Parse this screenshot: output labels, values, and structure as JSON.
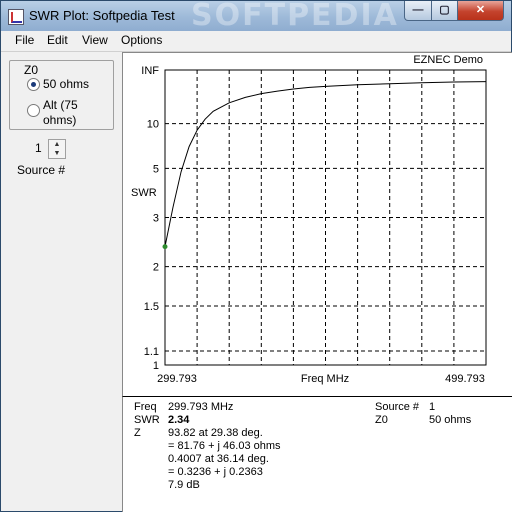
{
  "window": {
    "title": "SWR Plot: Softpedia Test",
    "watermark": "SOFTPEDIA",
    "buttons": {
      "minimize": "—",
      "maximize": "▢",
      "close": "✕"
    }
  },
  "menu": [
    "File",
    "Edit",
    "View",
    "Options"
  ],
  "z0_group": {
    "label": "Z0",
    "options": [
      {
        "label": "50 ohms",
        "selected": true
      },
      {
        "label": "Alt (75 ohms)",
        "selected": false
      }
    ]
  },
  "source": {
    "value": "1",
    "label": "Source #"
  },
  "chart_data": {
    "type": "line",
    "title": "EZNEC Demo",
    "xlabel": "Freq MHz",
    "ylabel": "SWR",
    "xlim": [
      299.793,
      499.793
    ],
    "x_tick_labels": [
      "299.793",
      "499.793"
    ],
    "y_tick_labels": [
      "INF",
      "10",
      "5",
      "3",
      "2",
      "1.5",
      "1.1",
      "1"
    ],
    "y_scale": "reflection-coefficient (SWR)",
    "grid": true,
    "series": [
      {
        "color": "#000000",
        "x": [
          299.793,
          304.8,
          309.8,
          314.8,
          319.8,
          324.8,
          329.8,
          339.8,
          349.8,
          359.8,
          369.8,
          379.8,
          389.8,
          399.8,
          419.8,
          439.8,
          459.8,
          479.8,
          499.793
        ],
        "y": [
          2.34,
          3.3,
          4.8,
          6.7,
          8.8,
          11.0,
          13.3,
          17.0,
          20.5,
          24.0,
          27.0,
          30.0,
          33.0,
          35.0,
          39.0,
          42.0,
          45.0,
          48.0,
          50.0
        ]
      }
    ],
    "marker": {
      "x": 299.793,
      "y": 2.34,
      "color": "#2e8b2e"
    }
  },
  "info": {
    "freq_label": "Freq",
    "freq_value": "299.793 MHz",
    "swr_label": "SWR",
    "swr_value": "2.34",
    "z_label": "Z",
    "z_lines": [
      "93.82 at 29.38 deg.",
      "= 81.76 + j 46.03 ohms",
      "0.4007 at 36.14 deg.",
      "= 0.3236 + j 0.2363",
      "7.9 dB"
    ],
    "source_label": "Source #",
    "source_value": "1",
    "z0_label": "Z0",
    "z0_value": "50 ohms"
  }
}
